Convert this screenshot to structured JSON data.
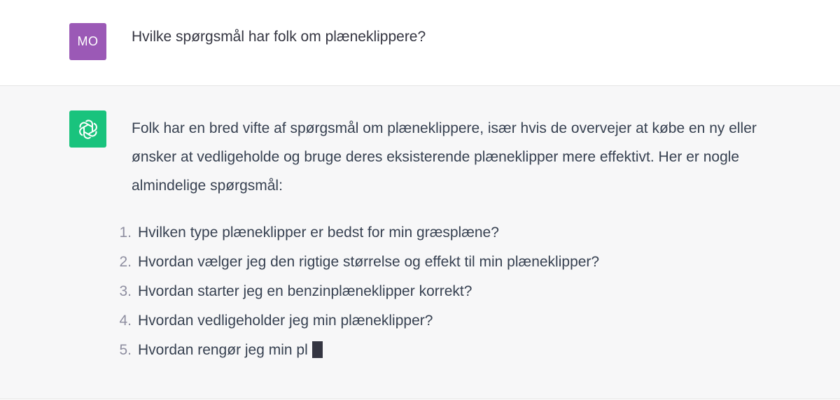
{
  "user_message": {
    "avatar_initials": "MO",
    "avatar_color": "#9b59b6",
    "text": "Hvilke spørgsmål har folk om plæneklippere?"
  },
  "assistant_message": {
    "avatar_icon": "openai-logo-icon",
    "avatar_color": "#19c37d",
    "intro": "Folk har en bred vifte af spørgsmål om plæneklippere, især hvis de overvejer at købe en ny eller ønsker at vedligeholde og bruge deres eksisterende plæneklipper mere effektivt. Her er nogle almindelige spørgsmål:",
    "items": [
      {
        "num": "1.",
        "text": "Hvilken type plæneklipper er bedst for min græsplæne?"
      },
      {
        "num": "2.",
        "text": "Hvordan vælger jeg den rigtige størrelse og effekt til min plæneklipper?"
      },
      {
        "num": "3.",
        "text": "Hvordan starter jeg en benzinplæneklipper korrekt?"
      },
      {
        "num": "4.",
        "text": "Hvordan vedligeholder jeg min plæneklipper?"
      },
      {
        "num": "5.",
        "text": "Hvordan rengør jeg min pl"
      }
    ]
  }
}
